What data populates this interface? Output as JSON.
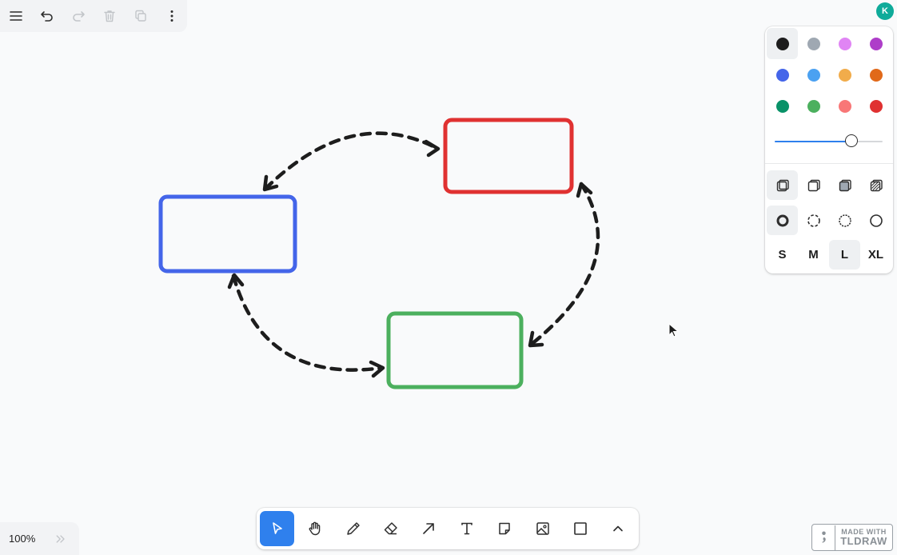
{
  "top_menu": {
    "icons": [
      "menu-icon",
      "undo-icon",
      "redo-icon",
      "trash-icon",
      "duplicate-icon",
      "more-vertical-icon"
    ]
  },
  "user": {
    "initial": "K",
    "color": "#0fab9a"
  },
  "style_panel": {
    "colors": [
      {
        "name": "black",
        "hex": "#1d1d1d",
        "selected": true
      },
      {
        "name": "grey",
        "hex": "#9fa8b2"
      },
      {
        "name": "light-violet",
        "hex": "#e085f4"
      },
      {
        "name": "violet",
        "hex": "#ae3ec9"
      },
      {
        "name": "blue",
        "hex": "#4465e9"
      },
      {
        "name": "light-blue",
        "hex": "#4ba1f1"
      },
      {
        "name": "yellow",
        "hex": "#f1ac4b"
      },
      {
        "name": "orange",
        "hex": "#e16919"
      },
      {
        "name": "green",
        "hex": "#099268"
      },
      {
        "name": "light-green",
        "hex": "#4cb05e"
      },
      {
        "name": "light-red",
        "hex": "#f87777"
      },
      {
        "name": "red",
        "hex": "#e03131"
      }
    ],
    "opacity": 0.71,
    "fill_styles": [
      "fill-none-icon",
      "fill-semi-icon",
      "fill-solid-icon",
      "fill-pattern-icon"
    ],
    "selected_fill": 0,
    "dash_styles": [
      "dash-draw-icon",
      "dash-dashed-icon",
      "dash-dotted-icon",
      "dash-solid-icon"
    ],
    "selected_dash": 0,
    "sizes": [
      "S",
      "M",
      "L",
      "XL"
    ],
    "selected_size": 2
  },
  "toolbar": {
    "tools": [
      "select-tool-icon",
      "hand-tool-icon",
      "draw-tool-icon",
      "eraser-tool-icon",
      "arrow-tool-icon",
      "text-tool-icon",
      "note-tool-icon",
      "image-tool-icon",
      "rectangle-tool-icon",
      "chevron-up-icon"
    ],
    "active": 0
  },
  "zoom": {
    "label": "100%"
  },
  "watermark": {
    "line1": "MADE WITH",
    "line2": "TLDRAW"
  },
  "canvas": {
    "shapes": [
      {
        "type": "rectangle",
        "color": "#e03131"
      },
      {
        "type": "rectangle",
        "color": "#4465e9"
      },
      {
        "type": "rectangle",
        "color": "#4cb05e"
      },
      {
        "type": "arrow",
        "style": "dashed",
        "color": "#1d1d1d",
        "heads": "both"
      },
      {
        "type": "arrow",
        "style": "dashed",
        "color": "#1d1d1d",
        "heads": "both"
      },
      {
        "type": "arrow",
        "style": "dashed",
        "color": "#1d1d1d",
        "heads": "both"
      }
    ]
  }
}
